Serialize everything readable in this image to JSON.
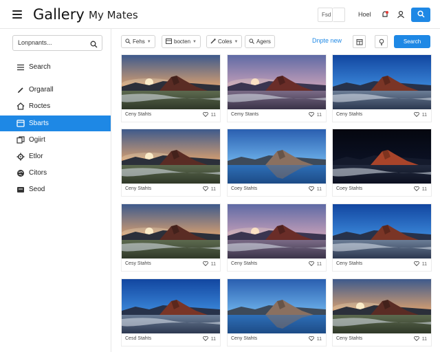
{
  "header": {
    "app_title": "Gallery",
    "section_title": "My Mates",
    "box_text": "Fsd",
    "user_text": "Hoel",
    "icons": [
      "menu-icon",
      "notification-icon",
      "user-icon",
      "search-icon"
    ]
  },
  "sidebar": {
    "search_text": "Lonpnants...",
    "items": [
      {
        "label": "Search",
        "icon": "list-icon",
        "active": false
      },
      {
        "label": "Orgarall",
        "icon": "pen-icon",
        "active": false
      },
      {
        "label": "Roctes",
        "icon": "home-icon",
        "active": false
      },
      {
        "label": "Sbarts",
        "icon": "folder-icon",
        "active": true
      },
      {
        "label": "Ogiirt",
        "icon": "copy-icon",
        "active": false
      },
      {
        "label": "Etlor",
        "icon": "gear-icon",
        "active": false
      },
      {
        "label": "Citors",
        "icon": "globe-icon",
        "active": false
      },
      {
        "label": "Seod",
        "icon": "card-icon",
        "active": false
      }
    ]
  },
  "toolbar": {
    "chips": [
      "Fehs",
      "bocten",
      "Coles",
      "Agers"
    ],
    "link": "Dnpte new",
    "primary_button": "Search"
  },
  "grid": {
    "cards": [
      {
        "caption": "Ceny Stahts",
        "count": "11",
        "scene": "sunset"
      },
      {
        "caption": "Cemy Stants",
        "count": "11",
        "scene": "dusk"
      },
      {
        "caption": "Ceny Stahts",
        "count": "11",
        "scene": "blue"
      },
      {
        "caption": "Ceny Stahts",
        "count": "11",
        "scene": "sunset"
      },
      {
        "caption": "Coey Stahts",
        "count": "11",
        "scene": "lake"
      },
      {
        "caption": "Coey Stahts",
        "count": "11",
        "scene": "night"
      },
      {
        "caption": "Cesy Stahts",
        "count": "11",
        "scene": "sunset"
      },
      {
        "caption": "Ceny Stahts",
        "count": "11",
        "scene": "dusk"
      },
      {
        "caption": "Ceny Stahts",
        "count": "11",
        "scene": "blue"
      },
      {
        "caption": "Cesd Stahts",
        "count": "11",
        "scene": "blue"
      },
      {
        "caption": "Ceny Stahts",
        "count": "11",
        "scene": "lake"
      },
      {
        "caption": "Ceny Stahts",
        "count": "11",
        "scene": "sunset"
      }
    ]
  },
  "colors": {
    "accent": "#1e88e5"
  }
}
